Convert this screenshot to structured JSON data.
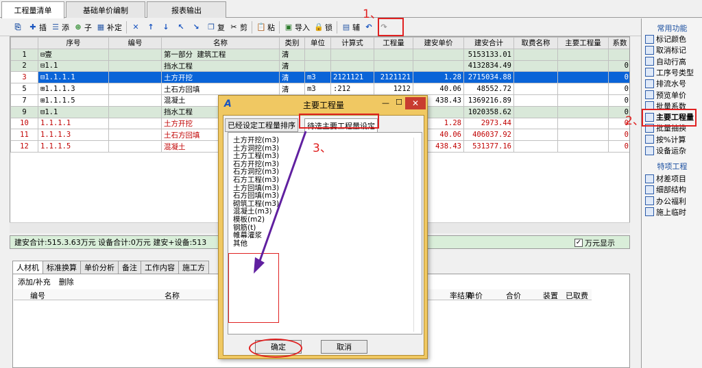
{
  "tabs": [
    "工程量清单",
    "基础单价编制",
    "报表输出"
  ],
  "toolbar": {
    "items": [
      {
        "icon": "tree-icon",
        "label": ""
      },
      {
        "icon": "plus-icon",
        "label": "插"
      },
      {
        "icon": "list-icon",
        "label": "添"
      },
      {
        "icon": "child-icon",
        "label": "子"
      },
      {
        "icon": "grid-icon",
        "label": "补定"
      },
      {
        "icon": "delete-icon",
        "label": ""
      },
      {
        "icon": "up-arrow-icon",
        "label": ""
      },
      {
        "icon": "down-arrow-icon",
        "label": ""
      },
      {
        "icon": "upleft-arrow-icon",
        "label": ""
      },
      {
        "icon": "downright-arrow-icon",
        "label": ""
      },
      {
        "icon": "copy-icon",
        "label": "复"
      },
      {
        "icon": "cut-icon",
        "label": "剪"
      },
      {
        "icon": "paste-icon",
        "label": "粘"
      },
      {
        "icon": "import-icon",
        "label": "导入"
      },
      {
        "icon": "lock-icon",
        "label": "锁"
      },
      {
        "icon": "aux-icon",
        "label": "辅"
      },
      {
        "icon": "undo-icon",
        "label": ""
      },
      {
        "icon": "redo-icon",
        "label": ""
      }
    ]
  },
  "grid": {
    "headers": [
      "",
      "序号",
      "编号",
      "名称",
      "类别",
      "单位",
      "计算式",
      "工程量",
      "建安单价",
      "建安合计",
      "取费名称",
      "主要工程量",
      "系数"
    ],
    "rows": [
      {
        "n": "1",
        "seq": "⊟壹",
        "code": "",
        "name": "第一部分  建筑工程",
        "cat": "清",
        "unit": "",
        "formula": "",
        "qty": "",
        "price": "",
        "total": "5153133.01",
        "fee": "",
        "main": "",
        "coef": "",
        "style": "sec"
      },
      {
        "n": "2",
        "seq": "  ⊟1.1",
        "code": "",
        "name": "挡水工程",
        "cat": "清",
        "unit": "",
        "formula": "",
        "qty": "",
        "price": "",
        "total": "4132834.49",
        "fee": "",
        "main": "",
        "coef": "0",
        "style": "sec"
      },
      {
        "n": "3",
        "seq": "   ⊟1.1.1.1",
        "code": "",
        "name": "土方开挖",
        "cat": "清",
        "unit": "m3",
        "formula": "2121121",
        "qty": "2121121",
        "price": "1.28",
        "total": "2715034.88",
        "fee": "",
        "main": "",
        "coef": "0",
        "style": "sel"
      },
      {
        "n": "5",
        "seq": "   ⊞1.1.1.3",
        "code": "",
        "name": "土石方回填",
        "cat": "清",
        "unit": "m3",
        "formula": ":212",
        "qty": "1212",
        "price": "40.06",
        "total": "48552.72",
        "fee": "",
        "main": "",
        "coef": "0",
        "style": ""
      },
      {
        "n": "7",
        "seq": "   ⊞1.1.1.5",
        "code": "",
        "name": "混凝土",
        "cat": "清",
        "unit": "",
        "formula": "",
        "qty": "",
        "price": "438.43",
        "total": "1369216.89",
        "fee": "",
        "main": "",
        "coef": "0",
        "style": ""
      },
      {
        "n": "9",
        "seq": "  ⊟1.1",
        "code": "",
        "name": "挡水工程",
        "cat": "",
        "unit": "",
        "formula": "",
        "qty": "",
        "price": "",
        "total": "1020358.62",
        "fee": "",
        "main": "",
        "coef": "0",
        "style": "sec"
      },
      {
        "n": "10",
        "seq": "    1.1.1.1",
        "code": "",
        "name": "土方开挖",
        "cat": "",
        "unit": "",
        "formula": "",
        "qty": "",
        "price": "1.28",
        "total": "2973.44",
        "fee": "",
        "main": "",
        "coef": "0",
        "style": "red"
      },
      {
        "n": "11",
        "seq": "    1.1.1.3",
        "code": "",
        "name": "土石方回填",
        "cat": "",
        "unit": "",
        "formula": "",
        "qty": "",
        "price": "40.06",
        "total": "406037.92",
        "fee": "",
        "main": "",
        "coef": "0",
        "style": "red"
      },
      {
        "n": "12",
        "seq": "    1.1.1.5",
        "code": "",
        "name": "混凝土",
        "cat": "",
        "unit": "",
        "formula": "",
        "qty": "",
        "price": "438.43",
        "total": "531377.16",
        "fee": "",
        "main": "",
        "coef": "0",
        "style": "red"
      }
    ]
  },
  "status": {
    "text": "建安合计:515.3.63万元 设备合计:0万元 建安+设备:513",
    "wanyuan_label": "万元显示",
    "wanyuan_checked": true
  },
  "bottom": {
    "tabs": [
      "人材机",
      "标准换算",
      "单价分析",
      "备注",
      "工作内容",
      "施工方"
    ],
    "actions": [
      "添加/补充",
      "删除"
    ],
    "headers": [
      "编号",
      "名称",
      "率结果",
      "单价",
      "合价",
      "装置",
      "已取费"
    ]
  },
  "right_panel": {
    "section1": "常用功能",
    "items1": [
      "标记颜色",
      "取消标记",
      "自动行高",
      "工序号类型",
      "排流水号",
      "预览单价",
      "批量系数",
      "主要工程量",
      "批量抽换",
      "按%计算",
      "设备运杂"
    ],
    "section2": "特项工程",
    "items2": [
      "材差项目",
      "细部结构",
      "办公福利",
      "施上临时"
    ]
  },
  "dialog": {
    "title": "主要工程量",
    "tab1": "已经设定工程量排序",
    "tab2": "待选主要工程量设定",
    "items": [
      "土方开挖(m3)",
      "土方洞挖(m3)",
      "土方工程(m3)",
      "石方开挖(m3)",
      "石方洞挖(m3)",
      "石方工程(m3)",
      "土方回填(m3)",
      "石方回填(m3)",
      "砌筑工程(m3)",
      "混凝土(m3)",
      "模板(m2)",
      "钢筋(t)",
      "帷幕灌浆",
      "其他"
    ],
    "ok": "确定",
    "cancel": "取消"
  },
  "annotations": {
    "step1": "1、",
    "step2": "2、",
    "step3": "3、"
  },
  "colors": {
    "selected": "#0a64d8",
    "section_row": "#d9e8d9",
    "dialog_frame": "#f0c862",
    "annotation": "#e02020",
    "red_text": "#c00000"
  }
}
